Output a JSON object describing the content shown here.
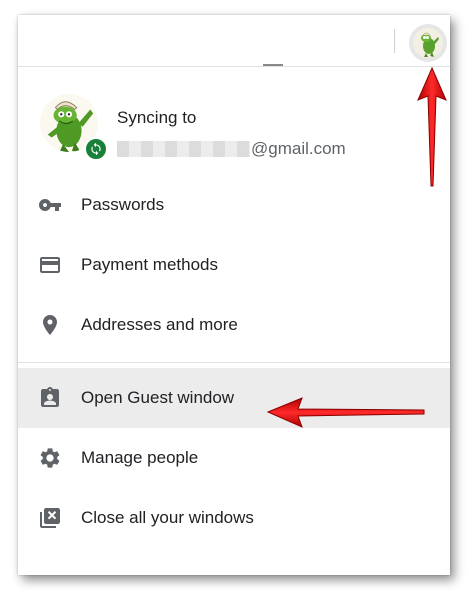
{
  "header": {
    "profile_button_label": ""
  },
  "profile": {
    "sync_label": "Syncing to",
    "email_domain": "@gmail.com"
  },
  "menu": {
    "autofill": [
      {
        "label": "Passwords",
        "icon": "key-icon"
      },
      {
        "label": "Payment methods",
        "icon": "credit-card-icon"
      },
      {
        "label": "Addresses and more",
        "icon": "location-pin-icon"
      }
    ],
    "profile_actions": [
      {
        "label": "Open Guest window",
        "icon": "guest-badge-icon",
        "highlighted": true
      },
      {
        "label": "Manage people",
        "icon": "gear-icon"
      },
      {
        "label": "Close all your windows",
        "icon": "close-windows-icon"
      }
    ]
  },
  "colors": {
    "icon": "#5f6368",
    "sync_badge": "#188038",
    "highlight": "#ececec",
    "annotation_arrow": "#e01010"
  }
}
